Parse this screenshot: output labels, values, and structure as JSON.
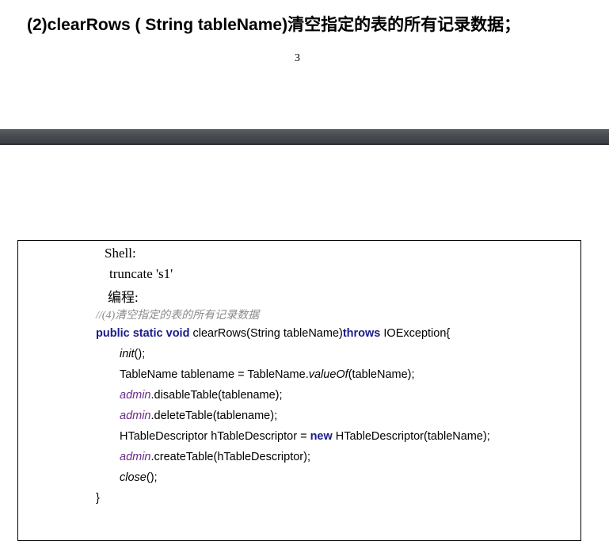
{
  "heading": "(2)clearRows  ( String tableName)清空指定的表的所有记录数据；",
  "page_number": "3",
  "code_box": {
    "shell_label": "Shell:",
    "shell_command": "truncate 's1'",
    "programming_label": "编程:",
    "comment": "//(4)清空指定的表的所有记录数据",
    "method_signature": {
      "modifiers": "public static void",
      "name_and_params": " clearRows(String tableName)",
      "throws_kw": "throws",
      "exception": " IOException{"
    },
    "lines": {
      "init_call": "init",
      "init_rest": "();",
      "tablename_prefix": "TableName tablename = TableName.",
      "tablename_method": "valueOf",
      "tablename_suffix": "(tableName);",
      "admin_field": "admin",
      "disable_call": ".disableTable(tablename);",
      "delete_call": ".deleteTable(tablename);",
      "descriptor_prefix": "HTableDescriptor hTableDescriptor = ",
      "new_kw": "new",
      "descriptor_suffix": " HTableDescriptor(tableName);",
      "create_call": ".createTable(hTableDescriptor);",
      "close_call": "close",
      "close_rest": "();",
      "closing_brace": "}"
    }
  }
}
